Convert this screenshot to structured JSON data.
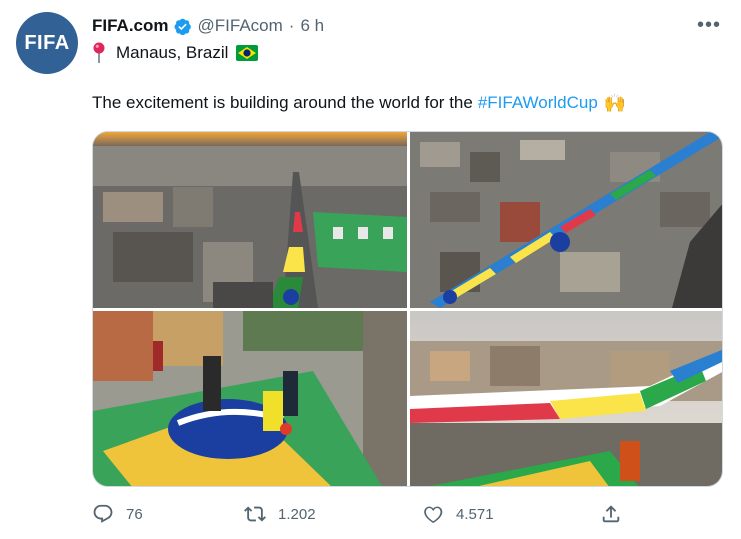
{
  "tweet": {
    "avatar_text": "FIFA",
    "display_name": "FIFA.com",
    "handle": "@FIFAcom",
    "separator": "·",
    "time": "6 h",
    "location": "Manaus, Brazil",
    "text": "The excitement is building around the world for the",
    "hashtag": "#FIFAWorldCup",
    "emoji": "🙌"
  },
  "icons": {
    "more": "more-icon",
    "verified": "verified-badge-icon",
    "pin": "round-pushpin-icon",
    "flag": "brazil-flag-icon",
    "reply": "reply-icon",
    "retweet": "retweet-icon",
    "like": "like-icon",
    "share": "share-icon"
  },
  "stats": {
    "replies": "76",
    "retweets": "1.202",
    "likes": "4.571"
  },
  "colors": {
    "accent": "#1d9bf0",
    "avatar_bg": "#326295",
    "muted": "#536471"
  }
}
